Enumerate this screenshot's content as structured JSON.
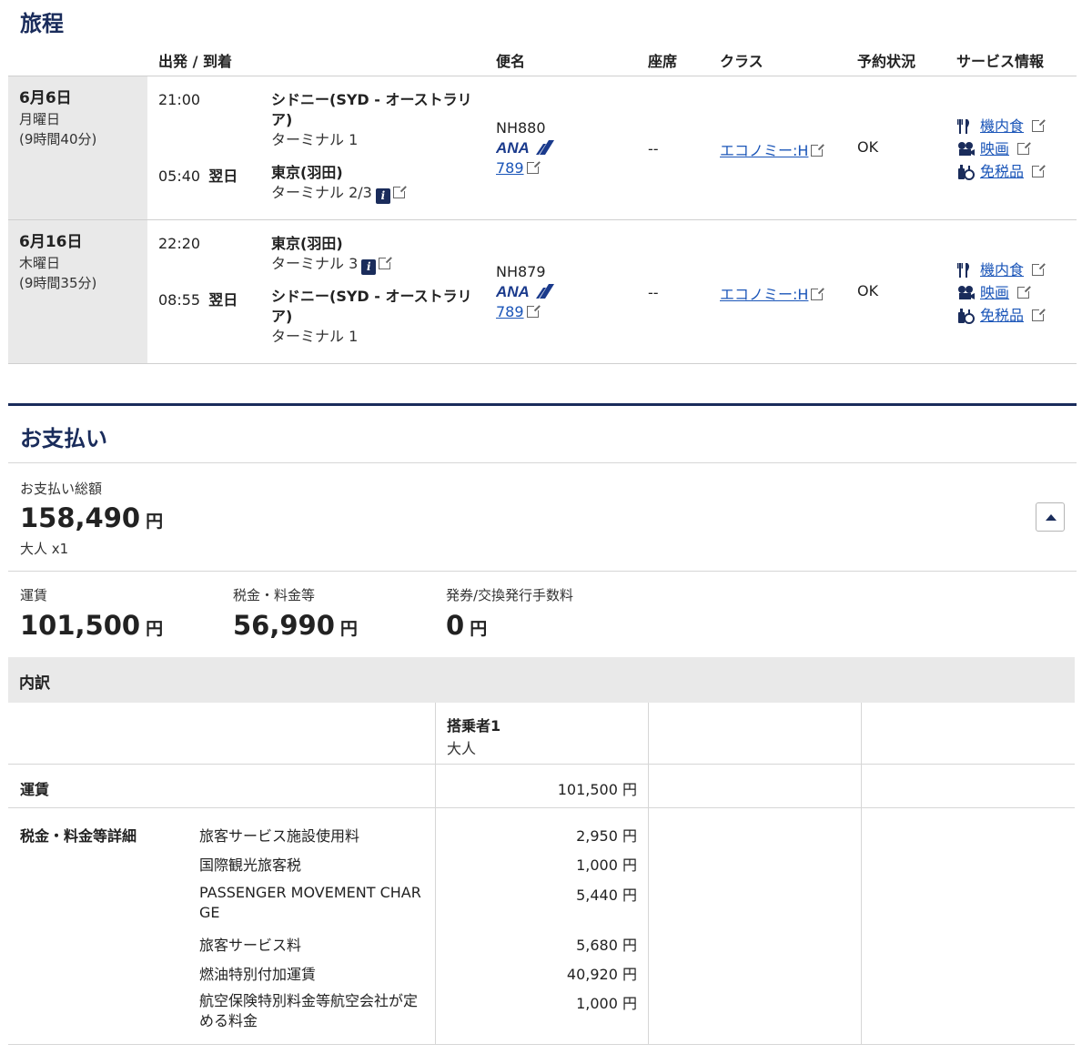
{
  "itinerary": {
    "title": "旅程",
    "headers": {
      "depart_arrive": "出発 / 到着",
      "flight": "便名",
      "seat": "座席",
      "class": "クラス",
      "status": "予約状況",
      "service": "サービス情報"
    },
    "flights": [
      {
        "date": "6月6日",
        "weekday": "月曜日",
        "duration": "(9時間40分)",
        "dep_time": "21:00",
        "dep_city": "シドニー(SYD - オーストラリア)",
        "dep_terminal": "ターミナル 1",
        "arr_time": "05:40",
        "arr_next": "翌日",
        "arr_city": "東京(羽田)",
        "arr_terminal": "ターミナル 2/3",
        "flight_no": "NH880",
        "aircraft": "789",
        "seat": "--",
        "class": "エコノミー:H",
        "status": "OK"
      },
      {
        "date": "6月16日",
        "weekday": "木曜日",
        "duration": "(9時間35分)",
        "dep_time": "22:20",
        "dep_city": "東京(羽田)",
        "dep_terminal": "ターミナル 3",
        "arr_time": "08:55",
        "arr_next": "翌日",
        "arr_city": "シドニー(SYD - オーストラリア)",
        "arr_terminal": "ターミナル 1",
        "flight_no": "NH879",
        "aircraft": "789",
        "seat": "--",
        "class": "エコノミー:H",
        "status": "OK"
      }
    ],
    "services": {
      "meal": "機内食",
      "movie": "映画",
      "dutyfree": "免税品"
    },
    "airline_logo": "ANA"
  },
  "payment": {
    "title": "お支払い",
    "total_label": "お支払い総額",
    "total_amount": "158,490",
    "yen": "円",
    "pax": "大人 x1",
    "fare_label": "運賃",
    "fare_amount": "101,500",
    "tax_label": "税金・料金等",
    "tax_amount": "56,990",
    "fee_label": "発券/交換発行手数料",
    "fee_amount": "0"
  },
  "breakdown": {
    "title": "内訳",
    "passenger": "搭乗者1",
    "passenger_type": "大人",
    "fare_label": "運賃",
    "fare_value": "101,500 円",
    "tax_detail_label": "税金・料金等詳細",
    "taxes": [
      {
        "name": "旅客サービス施設使用料",
        "value": "2,950 円"
      },
      {
        "name": "国際観光旅客税",
        "value": "1,000 円"
      },
      {
        "name": "PASSENGER MOVEMENT CHARGE",
        "value": "5,440 円"
      },
      {
        "name": "旅客サービス料",
        "value": "5,680 円"
      },
      {
        "name": "燃油特別付加運賃",
        "value": "40,920 円"
      },
      {
        "name": "航空保険特別料金等航空会社が定める料金",
        "value": "1,000 円"
      }
    ]
  },
  "colors": {
    "navy": "#1a2c5b",
    "link": "#1a55b8",
    "gray_bg": "#e9e9e9"
  }
}
